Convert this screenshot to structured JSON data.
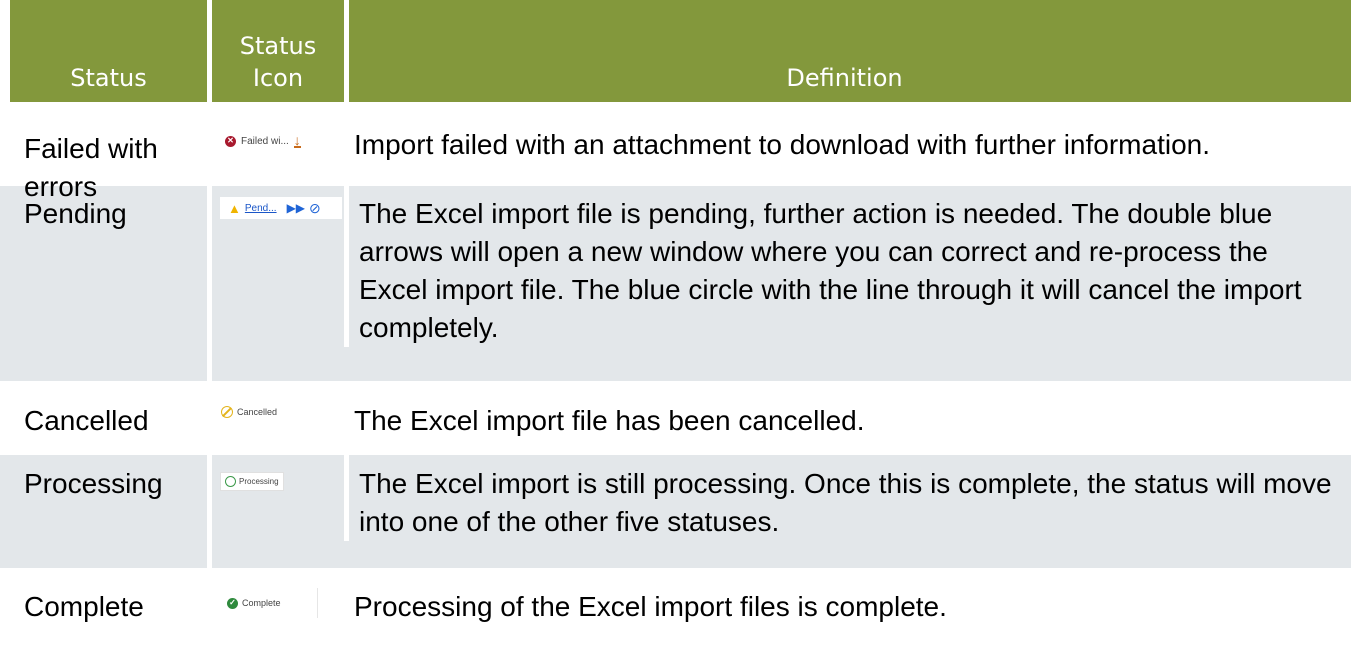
{
  "table": {
    "headers": {
      "status": "Status",
      "status_icon_line1": "Status",
      "status_icon_line2": "Icon",
      "definition": "Definition"
    },
    "rows": [
      {
        "status": "Failed with errors",
        "chip_label": "Failed wi...",
        "icon": "error-icon",
        "definition": "Import failed with an attachment to download with further information."
      },
      {
        "status": "Pending",
        "chip_label": "Pend...",
        "icon": "warning-icon",
        "definition": "The Excel import file is pending, further action is needed. The double blue arrows will open a new window where you can correct and re-process the Excel import file. The blue circle with the line through it will cancel the import completely."
      },
      {
        "status": "Cancelled",
        "chip_label": "Cancelled",
        "icon": "cancelled-icon",
        "definition": "The Excel import file has been cancelled."
      },
      {
        "status": "Processing",
        "chip_label": "Processing",
        "icon": "processing-icon",
        "definition": "The Excel import is still processing. Once this is complete, the status will move into one of the other five statuses."
      },
      {
        "status": "Complete",
        "chip_label": "Complete",
        "icon": "complete-icon",
        "definition": "Processing of the Excel import files is complete."
      }
    ]
  },
  "colors": {
    "header_bg": "#83983c",
    "shaded_row_bg": "#e3e7ea",
    "error_red": "#a8192e",
    "complete_green": "#2f8a3d",
    "warning_yellow": "#f0b400",
    "action_blue": "#1f64d6",
    "download_orange": "#c86a1a"
  }
}
